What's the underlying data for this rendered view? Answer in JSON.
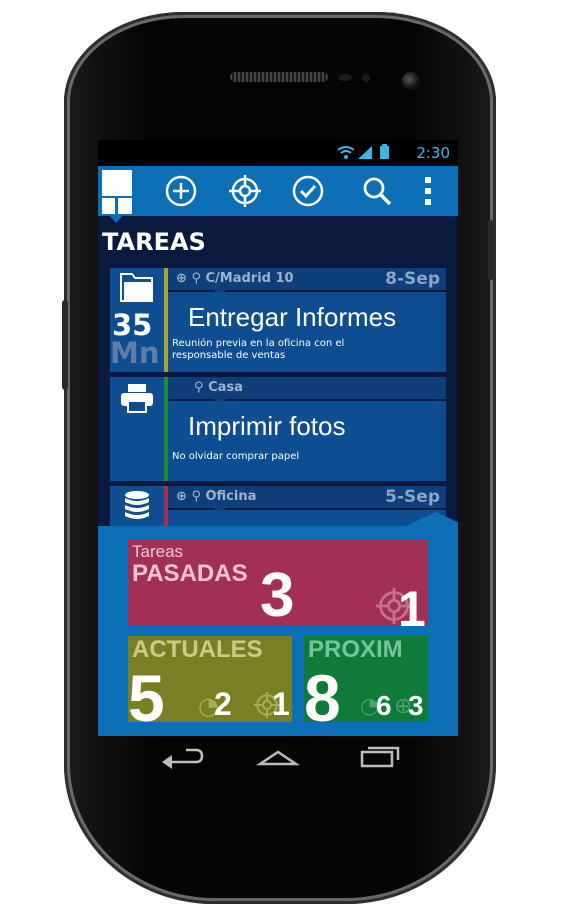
{
  "status_bar": {
    "time": "2:30"
  },
  "action_bar": {
    "icons": [
      "add-icon",
      "target-icon",
      "check-icon",
      "search-icon",
      "overflow-menu-icon"
    ]
  },
  "page_title": "TAREAS",
  "tasks": [
    {
      "location": "C/Madrid 10",
      "date": "8-Sep",
      "name": "Entregar Informes",
      "note": "Reunión previa en la oficina con el responsable de ventas",
      "counter_value": "35",
      "counter_unit": "Mn",
      "category_icon": "folder-icon",
      "bar_color": "#a5a23a"
    },
    {
      "location": "Casa",
      "date": "",
      "name": "Imprimir fotos",
      "note": "No olvidar comprar papel",
      "category_icon": "printer-icon",
      "bar_color": "#1e8a3e"
    },
    {
      "location": "Oficina",
      "date": "5-Sep",
      "name": "",
      "note": "",
      "category_icon": "database-icon",
      "bar_color": "#a23056"
    }
  ],
  "stats": {
    "past": {
      "small_label": "Tareas",
      "label": "PASADAS",
      "count": "3",
      "sub_count": "1",
      "color": "#a23056"
    },
    "current": {
      "label": "ACTUALES",
      "count": "5",
      "sub_a": "2",
      "sub_b": "1",
      "color": "#7a7f26"
    },
    "upcoming": {
      "label": "PROXIM",
      "count": "8",
      "sub_a": "6",
      "sub_b": "3",
      "color": "#0f7a3a"
    }
  }
}
